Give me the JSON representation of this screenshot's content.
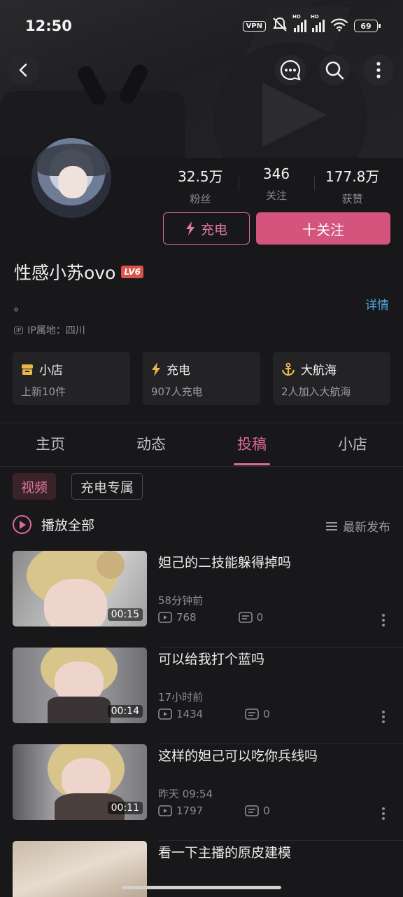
{
  "status_bar": {
    "time": "12:50",
    "vpn": "VPN",
    "battery": "69",
    "hd": "HD"
  },
  "profile": {
    "stats": [
      {
        "value": "32.5万",
        "label": "粉丝"
      },
      {
        "value": "346",
        "label": "关注"
      },
      {
        "value": "177.8万",
        "label": "获赞"
      }
    ],
    "charge_button": "充电",
    "follow_button": "十关注",
    "username": "性感小苏ovo",
    "level": "LV6",
    "signature": "。",
    "detail_link": "详情",
    "ip_badge": "IP",
    "ip_location": "IP属地：四川"
  },
  "cards": [
    {
      "icon": "shop-icon",
      "title": "小店",
      "subtitle": "上新10件"
    },
    {
      "icon": "lightning-icon",
      "title": "充电",
      "subtitle": "907人充电"
    },
    {
      "icon": "anchor-icon",
      "title": "大航海",
      "subtitle": "2人加入大航海"
    }
  ],
  "tabs": [
    "主页",
    "动态",
    "投稿",
    "小店"
  ],
  "active_tab": "投稿",
  "subtabs": [
    "视频",
    "充电专属"
  ],
  "play_all": "播放全部",
  "sort_label": "最新发布",
  "videos": [
    {
      "title": "妲己的二技能躲得掉吗",
      "duration": "00:15",
      "time": "58分钟前",
      "views": "768",
      "comments": "0"
    },
    {
      "title": "可以给我打个蓝吗",
      "duration": "00:14",
      "time": "17小时前",
      "views": "1434",
      "comments": "0"
    },
    {
      "title": "这样的妲己可以吃你兵线吗",
      "duration": "00:11",
      "time": "昨天 09:54",
      "views": "1797",
      "comments": "0"
    },
    {
      "title": "看一下主播的原皮建模",
      "duration": "",
      "time": "",
      "views": "",
      "comments": ""
    }
  ],
  "colors": {
    "accent": "#e06a93",
    "follow_bg": "#d4547e",
    "link": "#4da3e0",
    "background": "#18181a"
  }
}
